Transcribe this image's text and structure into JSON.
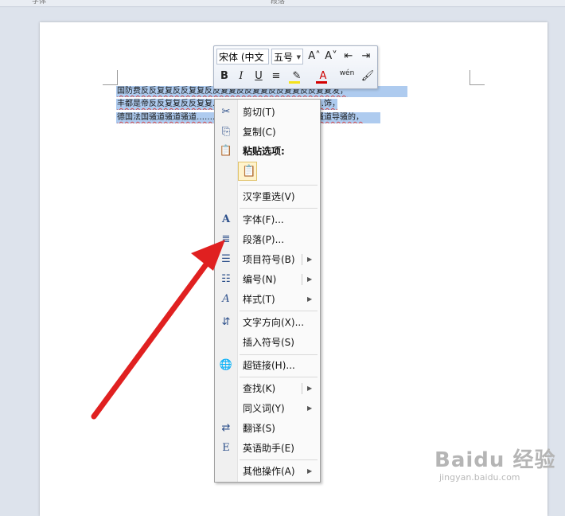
{
  "ruler": {
    "tabs": [
      "字体",
      "段落"
    ]
  },
  "document": {
    "lines": [
      "国防费反反复复反反复复反反复复反反复复反反复复反反复复发，",
      "丰都是帝反反复复反反复复……………………………………饰，",
      "德国法国骚道骚道骚道……………………………………道骚道导骚的，"
    ]
  },
  "mini_toolbar": {
    "font_name": "宋体 (中文",
    "font_size": "五号",
    "grow_font": "A˄",
    "shrink_font": "A˅",
    "bold": "B",
    "italic": "I",
    "underline": "U",
    "center": "≡",
    "font_color": "A",
    "phonetic": "wén",
    "colors": {
      "highlight": "#f5e21a",
      "font_red": "#d40000"
    }
  },
  "context_menu": {
    "items": [
      {
        "label": "剪切(T)",
        "icon": "scissors-icon",
        "glyph": "✂"
      },
      {
        "label": "复制(C)",
        "icon": "copy-icon",
        "glyph": "⎘"
      },
      {
        "label": "粘贴选项:",
        "icon": "paste-icon",
        "glyph": "📋"
      },
      {
        "label": "汉字重选(V)"
      },
      {
        "label": "字体(F)...",
        "icon": "font-icon",
        "glyph": "A"
      },
      {
        "label": "段落(P)...",
        "icon": "paragraph-icon",
        "glyph": "≣"
      },
      {
        "label": "项目符号(B)",
        "icon": "bullets-icon",
        "glyph": "☰"
      },
      {
        "label": "编号(N)",
        "icon": "numbering-icon",
        "glyph": "☷"
      },
      {
        "label": "样式(T)",
        "icon": "styles-icon",
        "glyph": "A"
      },
      {
        "label": "文字方向(X)...",
        "icon": "text-direction-icon",
        "glyph": "⇵"
      },
      {
        "label": "插入符号(S)"
      },
      {
        "label": "超链接(H)...",
        "icon": "hyperlink-icon",
        "glyph": "🌐"
      },
      {
        "label": "查找(K)"
      },
      {
        "label": "同义词(Y)"
      },
      {
        "label": "翻译(S)",
        "icon": "translate-icon",
        "glyph": "⇄"
      },
      {
        "label": "英语助手(E)",
        "icon": "english-assistant-icon",
        "glyph": "E"
      },
      {
        "label": "其他操作(A)"
      }
    ]
  },
  "watermark": {
    "brand": "Baidu 经验",
    "url": "jingyan.baidu.com"
  },
  "annotation": {
    "arrow_color": "#e02020"
  }
}
